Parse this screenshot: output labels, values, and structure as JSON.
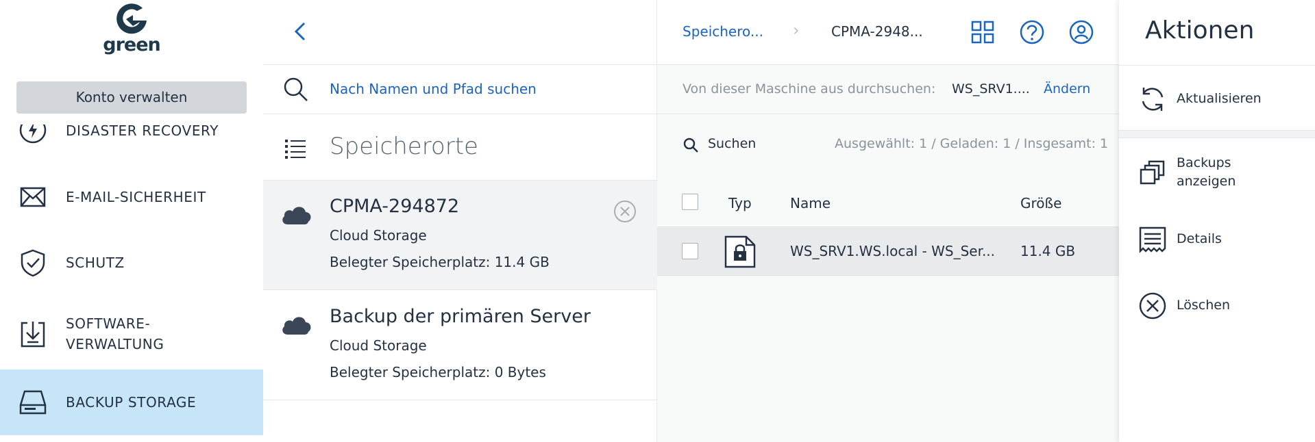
{
  "sidebar": {
    "logo_text": "green",
    "account_button": "Konto verwalten",
    "items": [
      {
        "label": "DISASTER RECOVERY",
        "icon": "disaster-recovery-icon"
      },
      {
        "label": "E-MAIL-SICHERHEIT",
        "icon": "envelope-icon"
      },
      {
        "label": "SCHUTZ",
        "icon": "shield-icon"
      },
      {
        "label": "SOFTWARE-",
        "label2": "VERWALTUNG",
        "icon": "software-download-icon"
      },
      {
        "label": "BACKUP STORAGE",
        "icon": "hard-drive-icon",
        "active": true
      }
    ]
  },
  "middle": {
    "search_placeholder": "Nach Namen und Pfad suchen",
    "locations_title": "Speicherorte",
    "locations": [
      {
        "name": "CPMA-294872",
        "type": "Cloud Storage",
        "used": "Belegter Speicherplatz: 11.4 GB",
        "selected": true
      },
      {
        "name": "Backup der primären Server",
        "type": "Cloud Storage",
        "used": "Belegter Speicherplatz: 0 Bytes",
        "selected": false
      }
    ]
  },
  "content": {
    "breadcrumb": {
      "parent": "Speichero...",
      "current": "CPMA-2948..."
    },
    "machine_label": "Von dieser Maschine aus durchsuchen:",
    "machine_value": "WS_SRV1....",
    "machine_change": "Ändern",
    "search_label": "Suchen",
    "stats": "Ausgewählt: 1 / Geladen: 1 / Insgesamt: 1",
    "columns": {
      "type": "Typ",
      "name": "Name",
      "size": "Größe"
    },
    "rows": [
      {
        "name": "WS_SRV1.WS.local - WS_Ser...",
        "size": "11.4 GB"
      }
    ]
  },
  "actions": {
    "title": "Aktionen",
    "items": [
      {
        "label": "Aktualisieren",
        "icon": "refresh-icon"
      },
      {
        "label": "Backups",
        "label2": "anzeigen",
        "icon": "backups-stack-icon"
      },
      {
        "label": "Details",
        "icon": "details-icon"
      },
      {
        "label": "Löschen",
        "icon": "delete-x-icon"
      }
    ]
  },
  "colors": {
    "accent": "#1a64be",
    "active_nav": "#c6e5f8",
    "text": "#243143"
  }
}
